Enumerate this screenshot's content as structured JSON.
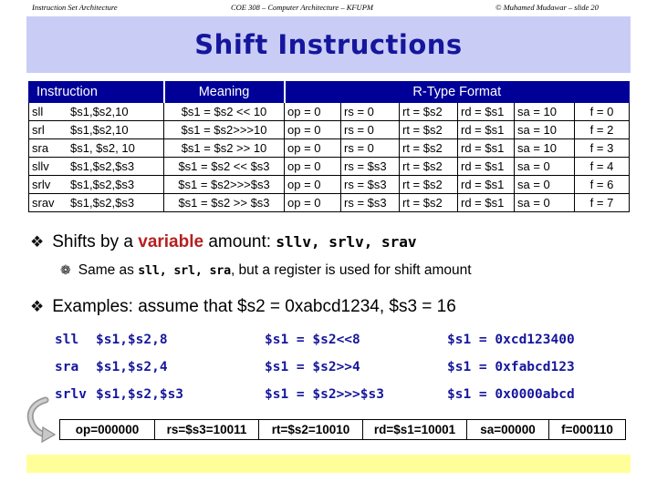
{
  "slide": {
    "title": "Shift Instructions"
  },
  "table": {
    "headers": {
      "instruction": "Instruction",
      "meaning": "Meaning",
      "rtype": "R-Type Format"
    },
    "rows": [
      {
        "mnemonic": "sll",
        "operands": "$s1,$s2,10",
        "meaning": "$s1 = $s2 << 10",
        "op": "op = 0",
        "rs": "rs = 0",
        "rt": "rt = $s2",
        "rd": "rd = $s1",
        "sa": "sa = 10",
        "f": "f = 0"
      },
      {
        "mnemonic": "srl",
        "operands": "$s1,$s2,10",
        "meaning": "$s1 = $s2>>>10",
        "op": "op = 0",
        "rs": "rs = 0",
        "rt": "rt = $s2",
        "rd": "rd = $s1",
        "sa": "sa = 10",
        "f": "f = 2"
      },
      {
        "mnemonic": "sra",
        "operands": "$s1, $s2, 10",
        "meaning": "$s1 = $s2 >> 10",
        "op": "op = 0",
        "rs": "rs = 0",
        "rt": "rt = $s2",
        "rd": "rd = $s1",
        "sa": "sa = 10",
        "f": "f = 3"
      },
      {
        "mnemonic": "sllv",
        "operands": "$s1,$s2,$s3",
        "meaning": "$s1 = $s2 << $s3",
        "op": "op = 0",
        "rs": "rs = $s3",
        "rt": "rt = $s2",
        "rd": "rd = $s1",
        "sa": "sa = 0",
        "f": "f = 4"
      },
      {
        "mnemonic": "srlv",
        "operands": "$s1,$s2,$s3",
        "meaning": "$s1 = $s2>>>$s3",
        "op": "op = 0",
        "rs": "rs = $s3",
        "rt": "rt = $s2",
        "rd": "rd = $s1",
        "sa": "sa = 0",
        "f": "f = 6"
      },
      {
        "mnemonic": "srav",
        "operands": "$s1,$s2,$s3",
        "meaning": "$s1 = $s2 >> $s3",
        "op": "op = 0",
        "rs": "rs = $s3",
        "rt": "rt = $s2",
        "rd": "rd = $s1",
        "sa": "sa = 0",
        "f": "f = 7"
      }
    ]
  },
  "bullets": {
    "shifts": {
      "glyph": "diamond-bullet-icon",
      "prefix": "Shifts by a ",
      "highlight": "variable",
      "suffix": " amount: ",
      "code": "sllv, srlv, srav"
    },
    "same_as": {
      "glyph": "diamond-outline-bullet-icon",
      "prefix": "Same as ",
      "code": "sll, srl, sra",
      "suffix": ", but a register is used for shift amount"
    },
    "examples": {
      "glyph": "diamond-bullet-icon",
      "text": "Examples: assume that $s2 = 0xabcd1234, $s3 = 16"
    }
  },
  "examples": [
    {
      "op": "sll",
      "args": "$s1,$s2,8",
      "meaning": "$s1 = $s2<<8",
      "result": "$s1 = 0xcd123400"
    },
    {
      "op": "sra",
      "args": "$s1,$s2,4",
      "meaning": "$s1 = $s2>>4",
      "result": "$s1 = 0xfabcd123"
    },
    {
      "op": "srlv",
      "args": "$s1,$s2,$s3",
      "meaning": "$s1 = $s2>>>$s3",
      "result": "$s1 = 0x0000abcd"
    }
  ],
  "encoding": {
    "fields": [
      "op=000000",
      "rs=$s3=10011",
      "rt=$s2=10010",
      "rd=$s1=10001",
      "sa=00000",
      "f=000110"
    ]
  },
  "footer": {
    "left": "Instruction Set Architecture",
    "center": "COE 308 – Computer Architecture – KFUPM",
    "right": "© Muhamed Mudawar – slide 20"
  },
  "colors": {
    "title_band": "#c9cdf6",
    "title_text": "#15169c",
    "table_header": "#000099",
    "highlight_red": "#b52020",
    "code_navy": "#15169c",
    "footer_band": "#ffff99"
  }
}
